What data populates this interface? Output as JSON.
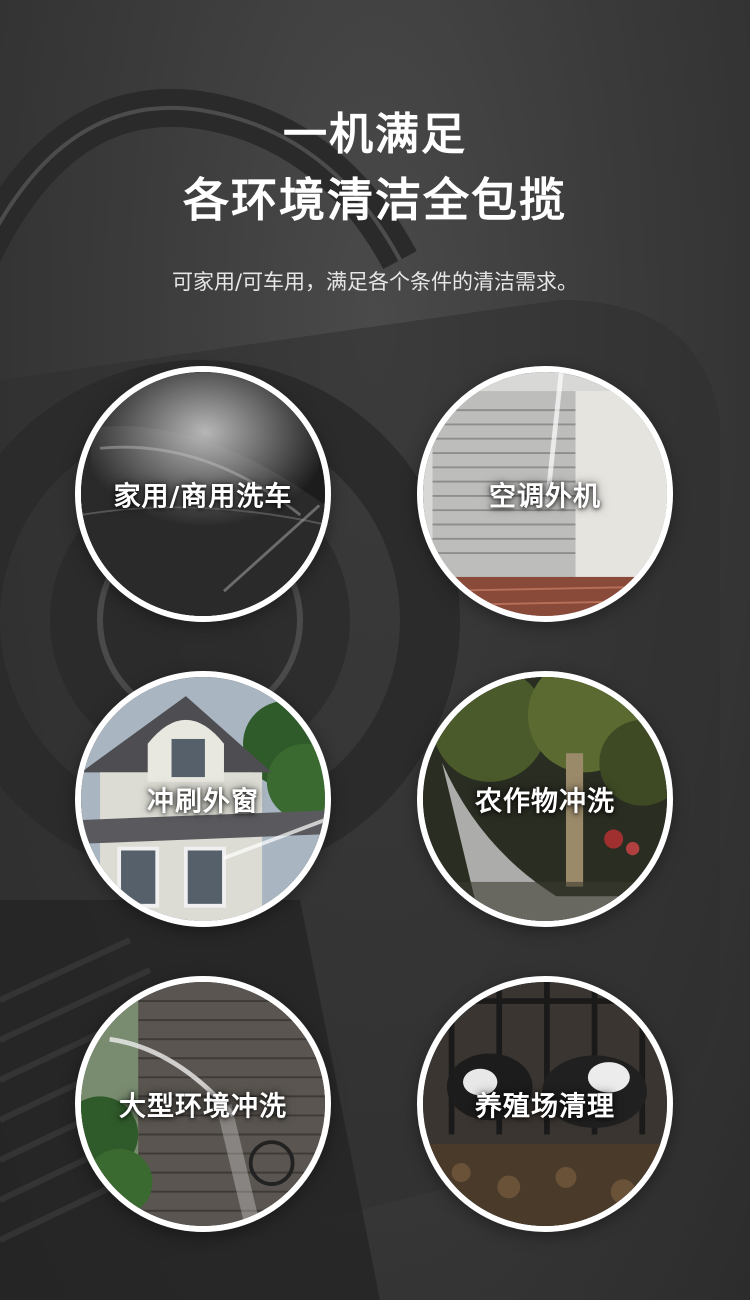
{
  "header": {
    "title_line1": "一机满足",
    "title_line2": "各环境清洁全包揽",
    "subtitle": "可家用/可车用，满足各个条件的清洁需求。"
  },
  "scenes": [
    {
      "label": "家用/商用洗车",
      "image": "car-washing-photo"
    },
    {
      "label": "空调外机",
      "image": "air-conditioner-unit-photo"
    },
    {
      "label": "冲刷外窗",
      "image": "house-windows-photo"
    },
    {
      "label": "农作物冲洗",
      "image": "crop-spraying-photo"
    },
    {
      "label": "大型环境冲洗",
      "image": "brick-wall-washing-photo"
    },
    {
      "label": "养殖场清理",
      "image": "livestock-farm-photo"
    }
  ],
  "colors": {
    "background": "#3a3a3a",
    "text": "#ffffff",
    "circle_border": "#ffffff"
  }
}
